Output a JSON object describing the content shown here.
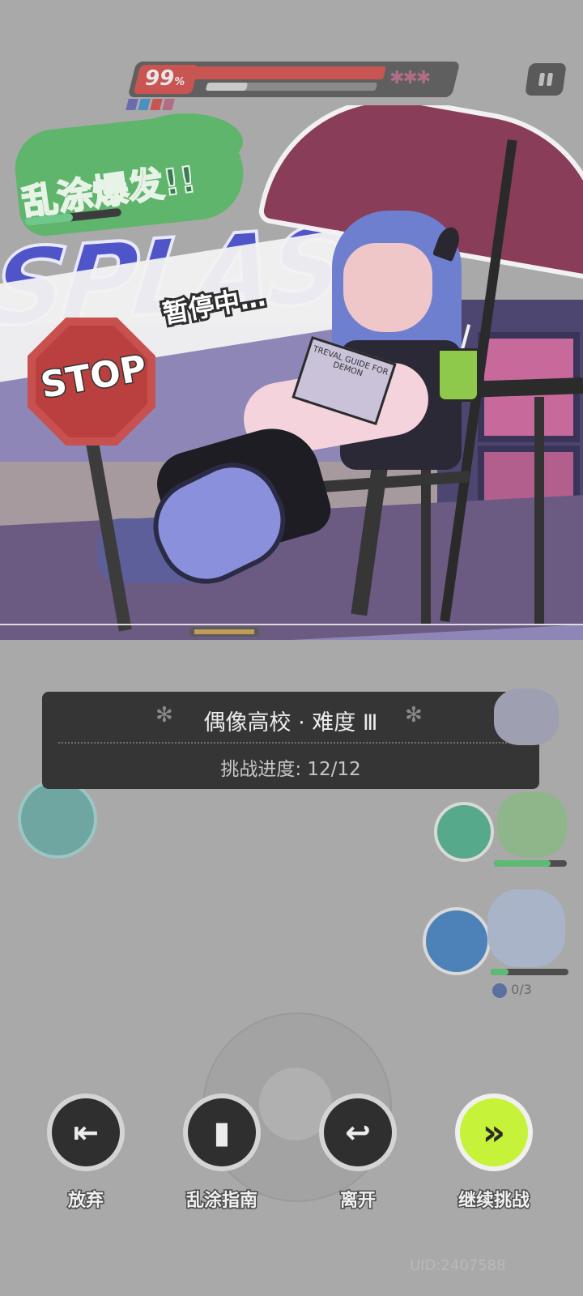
{
  "hud": {
    "hp_percent": "99",
    "hp_unit": "%",
    "hp_fill": 0.99,
    "splat_icons": "✱✱✱",
    "chip_colors": [
      "#6b6bb0",
      "#4c8fc0",
      "#c95553",
      "#b16d86"
    ]
  },
  "pause_button_icon": "pause-icon",
  "banner": {
    "burst_title": "乱涂爆发!!",
    "splash_text": "SPLASH",
    "paused_label": "暂停中…",
    "stop_sign": "STOP",
    "book_text": "TREVAL GUIDE FOR DEMON"
  },
  "stage": {
    "title": "偶像高校 · 难度 Ⅲ",
    "progress_text": "挑战进度:  12/12",
    "flower_icon": "✻"
  },
  "team": {
    "member3_count": "0/3"
  },
  "actions": [
    {
      "label": "放弃",
      "icon": "exit-door-icon",
      "glyph": "⇤"
    },
    {
      "label": "乱涂指南",
      "icon": "book-icon",
      "glyph": "▮"
    },
    {
      "label": "离开",
      "icon": "return-icon",
      "glyph": "↩"
    },
    {
      "label": "继续挑战",
      "icon": "double-chevron-icon",
      "glyph": "»"
    }
  ],
  "uid": "UID:2407588",
  "colors": {
    "accent": "#c6f23a",
    "panel": "#353535",
    "hp": "#c95553",
    "splash_blue": "#4f55c9",
    "burst_green": "#5fb56b"
  }
}
